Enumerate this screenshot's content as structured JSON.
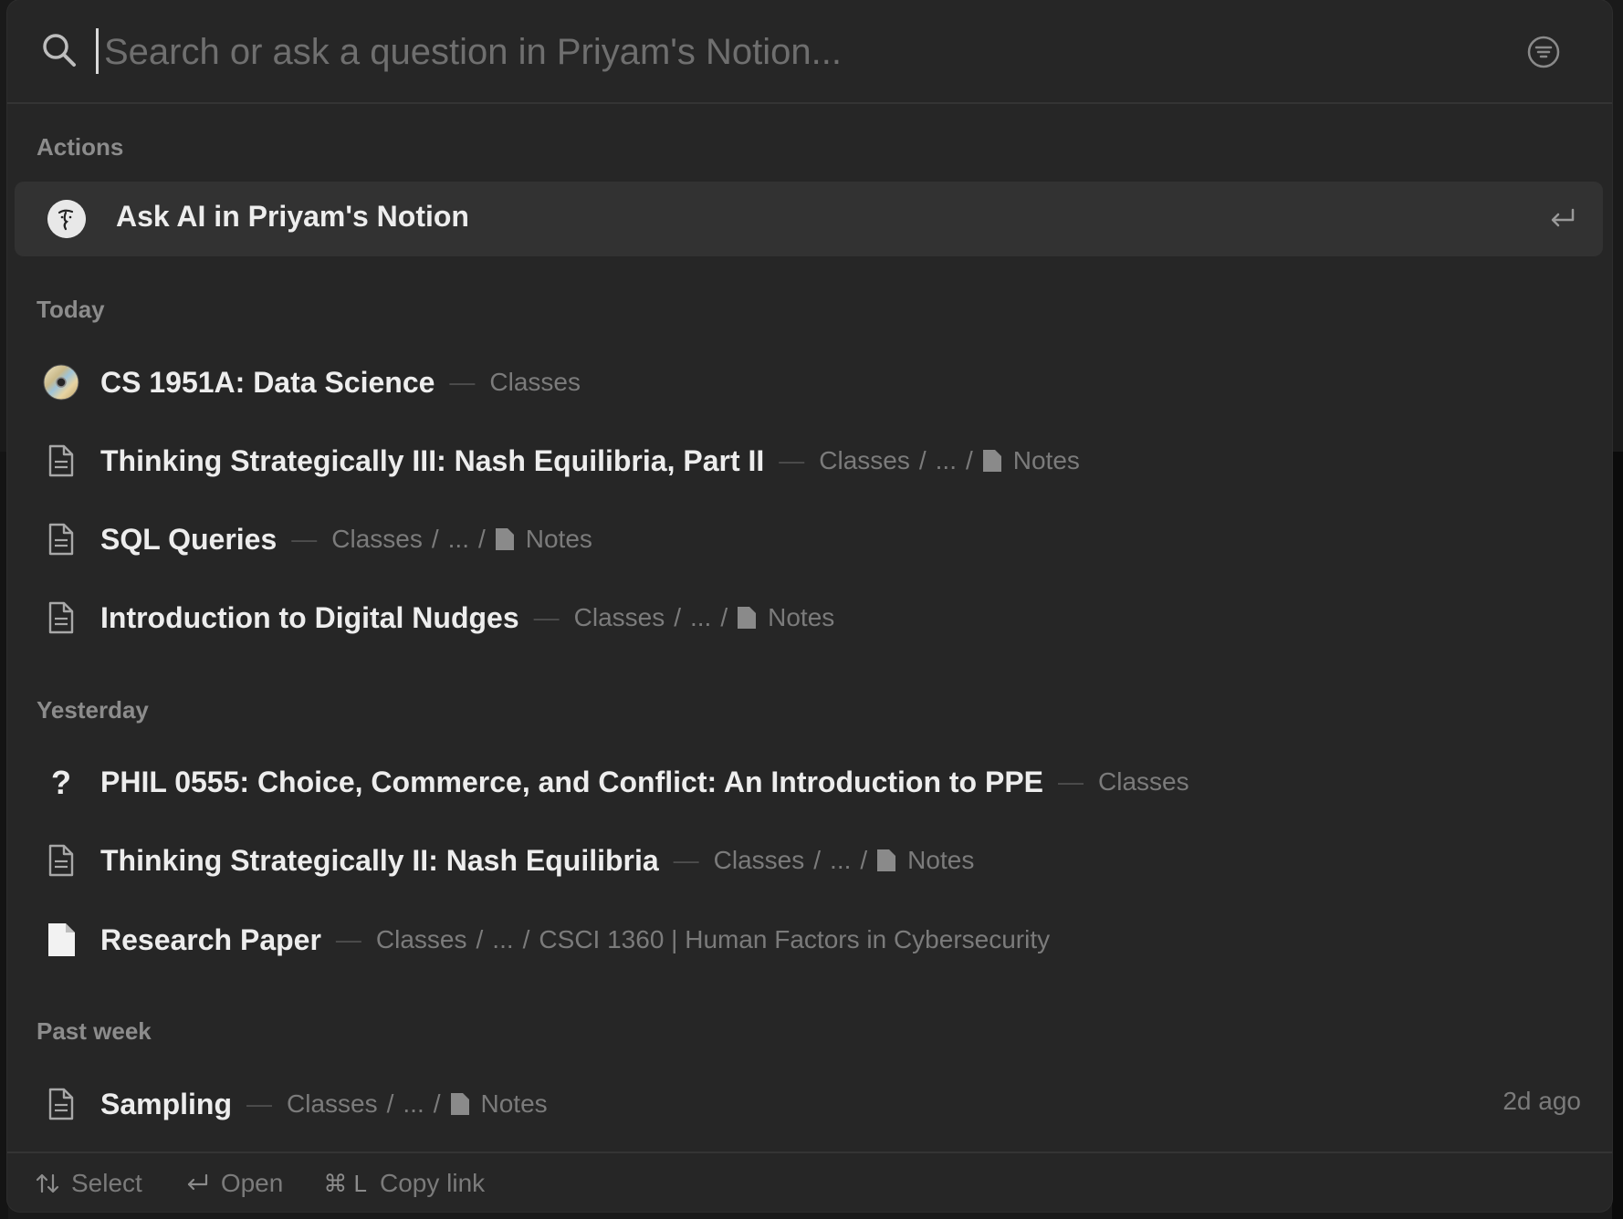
{
  "search": {
    "placeholder": "Search or ask a question in Priyam's Notion..."
  },
  "sections": {
    "actions": "Actions",
    "today": "Today",
    "yesterday": "Yesterday",
    "past_week": "Past week"
  },
  "ai_action": {
    "label": "Ask AI in Priyam's Notion"
  },
  "items": [
    {
      "title": "CS 1951A: Data Science",
      "crumbs": [
        "Classes"
      ],
      "icon": "cd-icon"
    },
    {
      "title": "Thinking Strategically III: Nash Equilibria, Part II",
      "crumbs": [
        "Classes",
        "...",
        "Notes"
      ],
      "icon": "page-icon"
    },
    {
      "title": "SQL Queries",
      "crumbs": [
        "Classes",
        "...",
        "Notes"
      ],
      "icon": "page-icon"
    },
    {
      "title": "Introduction to Digital Nudges",
      "crumbs": [
        "Classes",
        "...",
        "Notes"
      ],
      "icon": "page-icon"
    },
    {
      "title": "PHIL 0555: Choice, Commerce, and Conflict: An Introduction to PPE",
      "crumbs": [
        "Classes"
      ],
      "icon": "question-icon"
    },
    {
      "title": "Thinking Strategically II: Nash Equilibria",
      "crumbs": [
        "Classes",
        "...",
        "Notes"
      ],
      "icon": "page-icon"
    },
    {
      "title": "Research Paper",
      "crumbs": [
        "Classes",
        "...",
        "CSCI 1360 | Human Factors in Cybersecurity"
      ],
      "icon": "filled-page-icon"
    },
    {
      "title": "Sampling",
      "crumbs": [
        "Classes",
        "...",
        "Notes"
      ],
      "icon": "page-icon",
      "time": "2d ago"
    }
  ],
  "footer": {
    "select_label": "Select",
    "open_label": "Open",
    "copy_shortcut": "⌘ L",
    "copy_label": "Copy link"
  },
  "colors": {
    "panel_bg": "#262626",
    "highlight_bg": "#323232",
    "text": "#ededed",
    "muted": "#7b7b7b"
  }
}
